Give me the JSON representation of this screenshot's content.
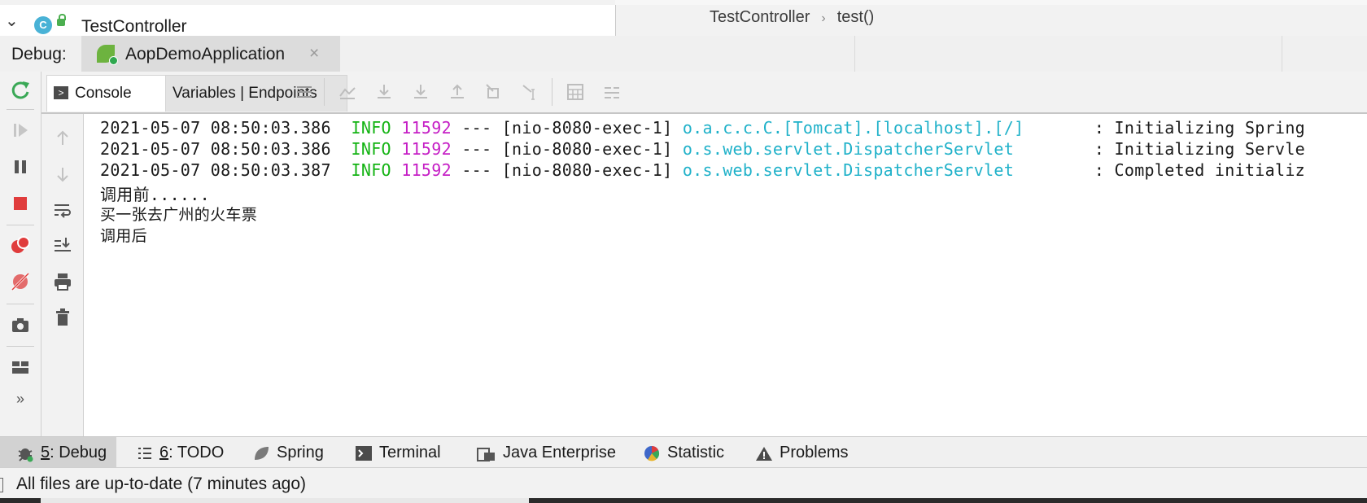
{
  "structure": {
    "class_badge": "C",
    "class_name": "TestController"
  },
  "breadcrumb": {
    "items": [
      "TestController",
      "test()"
    ],
    "separator": "›"
  },
  "debug": {
    "title": "Debug:",
    "tab_label": "AopDemoApplication",
    "close_glyph": "×"
  },
  "console_tabs": {
    "console": "Console",
    "variables": "Variables | Endpoints"
  },
  "log_lines": [
    {
      "ts": "2021-05-07 08:50:03.386",
      "level": "INFO",
      "pid": "11592",
      "sep": "---",
      "thread": "[nio-8080-exec-1]",
      "logger": "o.a.c.c.C.[Tomcat].[localhost].[/]",
      "msg": ": Initializing Spring"
    },
    {
      "ts": "2021-05-07 08:50:03.386",
      "level": "INFO",
      "pid": "11592",
      "sep": "---",
      "thread": "[nio-8080-exec-1]",
      "logger": "o.s.web.servlet.DispatcherServlet",
      "msg": ": Initializing Servle"
    },
    {
      "ts": "2021-05-07 08:50:03.387",
      "level": "INFO",
      "pid": "11592",
      "sep": "---",
      "thread": "[nio-8080-exec-1]",
      "logger": "o.s.web.servlet.DispatcherServlet",
      "msg": ": Completed initializ"
    }
  ],
  "output_lines": [
    "调用前......",
    "买一张去广州的火车票",
    "调用后"
  ],
  "bottom_tabs": [
    {
      "num": "5",
      "label": ": Debug",
      "icon": "bug-icon",
      "active": true
    },
    {
      "num": "6",
      "label": ": TODO",
      "icon": "list-icon"
    },
    {
      "num": "",
      "label": "Spring",
      "icon": "spring-leaf-icon"
    },
    {
      "num": "",
      "label": "Terminal",
      "icon": "terminal-icon"
    },
    {
      "num": "",
      "label": "Java Enterprise",
      "icon": "java-enterprise-icon"
    },
    {
      "num": "",
      "label": "Statistic",
      "icon": "statistic-icon"
    },
    {
      "num": "",
      "label": "Problems",
      "icon": "warning-icon"
    }
  ],
  "status": {
    "text": "All files are up-to-date (7 minutes ago)"
  },
  "colors": {
    "info": "#13b313",
    "pid": "#c51ec5",
    "logger": "#1fb1c9",
    "stop": "#e03c3c",
    "rerun": "#3aa856"
  }
}
